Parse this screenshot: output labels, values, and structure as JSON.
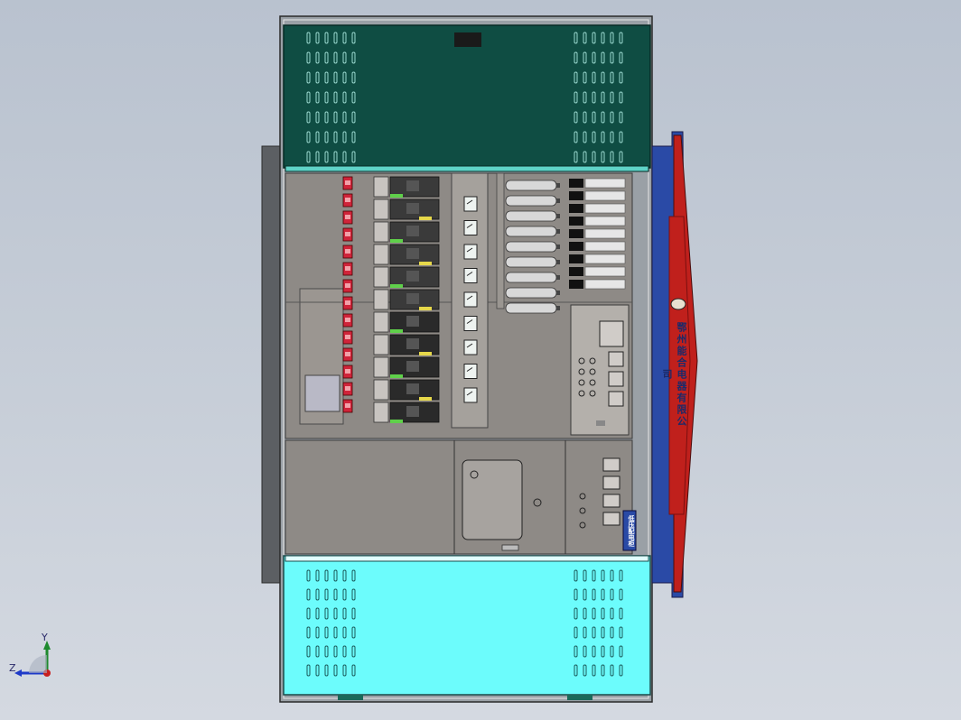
{
  "view": {
    "background_color": "#c3cad5",
    "cabinet_frame_color": "#9aa0a6",
    "panel_fill_color": "#8e8a86"
  },
  "top_door": {
    "color": "#0f4d43"
  },
  "bottom_door": {
    "color": "#6cfcfc"
  },
  "side_signboard": {
    "color_outer": "#2a4aa6",
    "color_inner": "#c0201c",
    "text": "鄂州能合电器有限公司"
  },
  "nameplate_tag": {
    "text": "低压配电柜",
    "color": "#2a4aa6"
  },
  "orientation_triad": {
    "y_label": "Y",
    "z_label": "Z",
    "y_color": "#1e8a2e",
    "z_color": "#1e3ac8",
    "x_color": "#c81e1e"
  }
}
